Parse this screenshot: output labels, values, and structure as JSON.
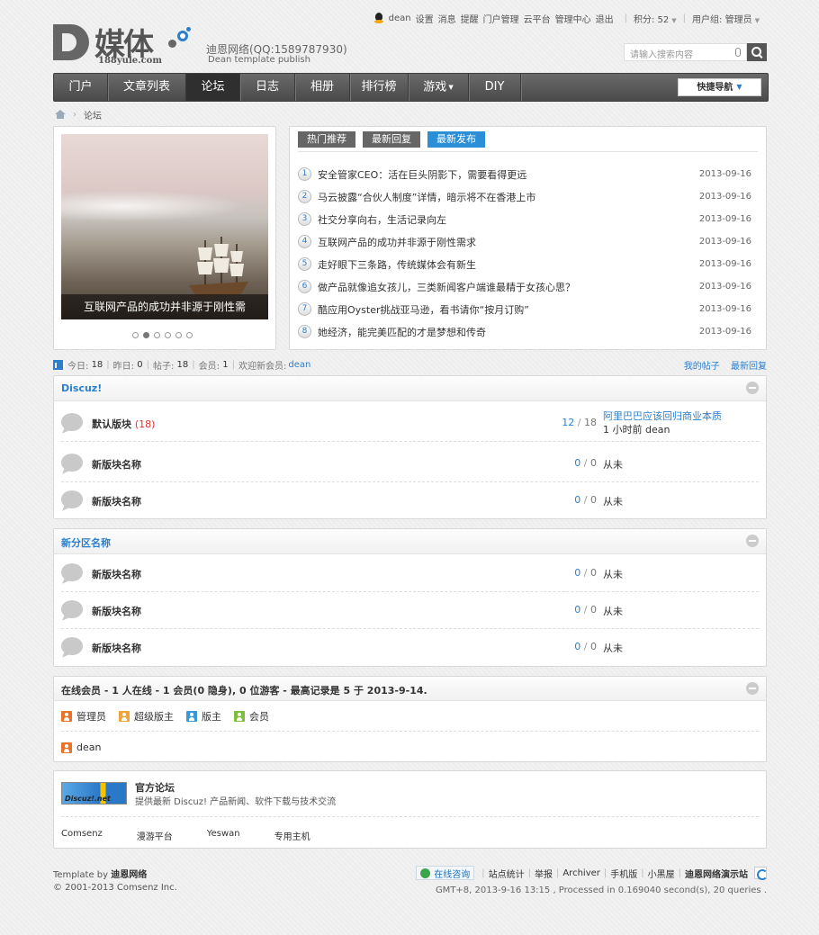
{
  "topbar": {
    "username": "dean",
    "links": [
      "设置",
      "消息",
      "提醒",
      "门户管理",
      "云平台",
      "管理中心",
      "退出"
    ],
    "points_label": "积分: 52",
    "usergroup_label": "用户组: 管理员"
  },
  "header": {
    "logo_text": "媒体",
    "logo_sub": "188yule.com",
    "site_title": "迪恩网络(QQ:1589787930)",
    "site_subtitle": "Dean template publish",
    "search_placeholder": "请输入搜索内容"
  },
  "nav": {
    "items": [
      {
        "label": "门户"
      },
      {
        "label": "文章列表"
      },
      {
        "label": "论坛"
      },
      {
        "label": "日志"
      },
      {
        "label": "相册"
      },
      {
        "label": "排行榜"
      },
      {
        "label": "游戏"
      },
      {
        "label": "DIY"
      }
    ],
    "active": "论坛",
    "quick_nav": "快捷导航"
  },
  "breadcrumb": {
    "current": "论坛"
  },
  "slider": {
    "caption": "互联网产品的成功并非源于刚性需",
    "dot_count": 6,
    "active_dot": 2
  },
  "news": {
    "tabs": [
      "热门推荐",
      "最新回复",
      "最新发布"
    ],
    "active_tab": "最新发布",
    "items": [
      {
        "num": "1",
        "title": "安全管家CEO：活在巨头阴影下，需要看得更远",
        "date": "2013-09-16"
      },
      {
        "num": "2",
        "title": "马云披露“合伙人制度”详情，暗示将不在香港上市",
        "date": "2013-09-16"
      },
      {
        "num": "3",
        "title": "社交分享向右，生活记录向左",
        "date": "2013-09-16"
      },
      {
        "num": "4",
        "title": "互联网产品的成功并非源于刚性需求",
        "date": "2013-09-16"
      },
      {
        "num": "5",
        "title": "走好眼下三条路，传统媒体会有新生",
        "date": "2013-09-16"
      },
      {
        "num": "6",
        "title": "做产品就像追女孩儿，三类新闻客户端谁最精于女孩心思？",
        "date": "2013-09-16"
      },
      {
        "num": "7",
        "title": "酷应用Oyster挑战亚马逊，看书请你“按月订购”",
        "date": "2013-09-16"
      },
      {
        "num": "8",
        "title": "她经济，能完美匹配的才是梦想和传奇",
        "date": "2013-09-16"
      }
    ]
  },
  "stats": {
    "today_label": "今日:",
    "today": "18",
    "yesterday_label": "昨日:",
    "yesterday": "0",
    "posts_label": "帖子:",
    "posts": "18",
    "members_label": "会员:",
    "members": "1",
    "welcome_label": "欢迎新会员:",
    "new_member": "dean",
    "my_posts": "我的帖子",
    "latest_replies": "最新回复"
  },
  "groups": [
    {
      "name": "Discuz!",
      "forums": [
        {
          "name": "默认版块",
          "today": "(18)",
          "threads": "12",
          "posts": "18",
          "last_title": "阿里巴巴应该回归商业本质",
          "last_meta": "1 小时前 dean"
        },
        {
          "name": "新版块名称",
          "today": "",
          "threads": "0",
          "posts": "0",
          "last_title": "",
          "last_meta": "从未"
        },
        {
          "name": "新版块名称",
          "today": "",
          "threads": "0",
          "posts": "0",
          "last_title": "",
          "last_meta": "从未"
        }
      ]
    },
    {
      "name": "新分区名称",
      "forums": [
        {
          "name": "新版块名称",
          "today": "",
          "threads": "0",
          "posts": "0",
          "last_title": "",
          "last_meta": "从未"
        },
        {
          "name": "新版块名称",
          "today": "",
          "threads": "0",
          "posts": "0",
          "last_title": "",
          "last_meta": "从未"
        },
        {
          "name": "新版块名称",
          "today": "",
          "threads": "0",
          "posts": "0",
          "last_title": "",
          "last_meta": "从未"
        }
      ]
    }
  ],
  "online": {
    "title": "在线会员 - 1 人在线 - 1 会员(0 隐身), 0 位游客 - 最高记录是 5 于 2013-9-14.",
    "legend": [
      {
        "label": "管理员",
        "color": "#e8742a"
      },
      {
        "label": "超级版主",
        "color": "#f0a33a"
      },
      {
        "label": "版主",
        "color": "#3a9ad9"
      },
      {
        "label": "会员",
        "color": "#7cbf3a"
      }
    ],
    "users": [
      {
        "name": "dean",
        "color": "#e8742a"
      }
    ]
  },
  "official": {
    "logo_text": "Discuz!.net",
    "title": "官方论坛",
    "desc": "提供最新 Discuz! 产品新闻、软件下载与技术交流",
    "links": [
      "Comsenz",
      "漫游平台",
      "Yeswan",
      "专用主机"
    ]
  },
  "footer": {
    "template_by_label": "Template by",
    "template_by": "迪恩网络",
    "copyright": "© 2001-2013 Comsenz Inc.",
    "consult": "在线咨询",
    "links": [
      "站点统计",
      "举报",
      "Archiver",
      "手机版",
      "小黑屋"
    ],
    "site_name": "迪恩网络演示站",
    "debug": "GMT+8, 2013-9-16 13:15 , Processed in 0.169040 second(s), 20 queries ."
  },
  "colors": {
    "accent": "#2a7fcf",
    "nav_bg": "#555555",
    "active_tab": "#2a8fd6"
  }
}
